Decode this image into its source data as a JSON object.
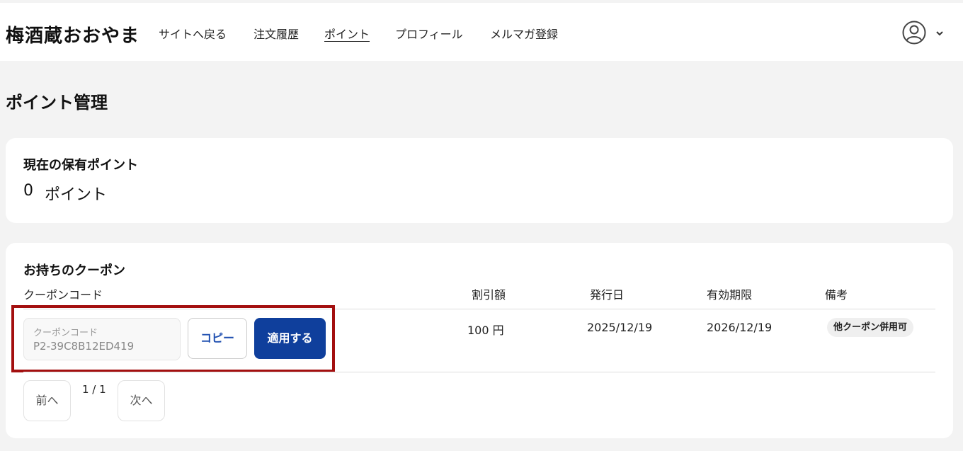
{
  "header": {
    "brand": "梅酒蔵おおやま",
    "nav": [
      "サイトへ戻る",
      "注文履歴",
      "ポイント",
      "プロフィール",
      "メルマガ登録"
    ],
    "active_nav": "ポイント",
    "user_icon": "user-circle-icon",
    "menu_icon": "chevron-down-icon"
  },
  "page": {
    "title": "ポイント管理"
  },
  "points": {
    "label": "現在の保有ポイント",
    "value": "0",
    "unit": "ポイント"
  },
  "coupons": {
    "title": "お持ちのクーポン",
    "columns": [
      "クーポンコード",
      "割引額",
      "発行日",
      "有効期限",
      "備考"
    ],
    "rows": [
      {
        "code_label": "クーポンコード",
        "code": "P2-39C8B12ED419",
        "copy_label": "コピー",
        "apply_label": "適用する",
        "discount": "100 円",
        "issued": "2025/12/19",
        "expires": "2026/12/19",
        "note": "他クーポン併用可"
      }
    ],
    "pagination": {
      "prev_label": "前へ",
      "next_label": "次へ",
      "info": "1 / 1"
    }
  },
  "colors": {
    "primary": "#0f3f9c",
    "highlight": "#a30f0f",
    "background": "#f3f3f3"
  }
}
